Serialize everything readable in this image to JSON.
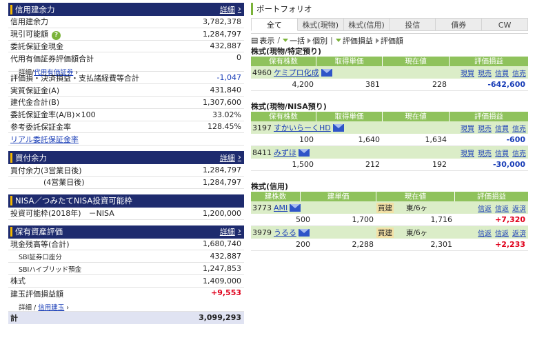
{
  "credit": {
    "title": "信用建余力",
    "detail": "詳細",
    "rows": [
      {
        "label": "信用建余力",
        "value": "3,782,378"
      },
      {
        "label": "現引可能額",
        "value": "1,284,797"
      },
      {
        "label": "委託保証金現金",
        "value": "432,887"
      },
      {
        "label": "代用有価証券評価額合計",
        "value": "0",
        "sub_prefix": "詳細/",
        "sub_link": "代用有価証券"
      },
      {
        "label": "評価損・決済損益・支払諸経費等合計",
        "value": "-1,047"
      },
      {
        "label": "実質保証金(A)",
        "value": "431,840"
      },
      {
        "label": "建代金合計(B)",
        "value": "1,307,600"
      },
      {
        "label": "委託保証金率(A/B)×100",
        "value": "33.02%"
      },
      {
        "label": "参考委託保証金率",
        "value": "128.45%"
      }
    ],
    "real_link": "リアル委託保証金率"
  },
  "buying": {
    "title": "買付余力",
    "detail": "詳細",
    "rows": [
      {
        "label": "買付余力(3営業日後)",
        "value": "1,284,797"
      },
      {
        "label": "(4営業日後)",
        "value": "1,284,797"
      }
    ]
  },
  "nisa": {
    "title": "NISA／つみたてNISA投資可能枠",
    "row": {
      "label": "投資可能枠(2018年)　－NISA",
      "value": "1,200,000"
    }
  },
  "assets": {
    "title": "保有資産評価",
    "detail": "詳細",
    "rows": [
      {
        "label": "現金残高等(合計)",
        "value": "1,680,740"
      },
      {
        "label": "SBI証券口座分",
        "value": "432,887",
        "sub": true
      },
      {
        "label": "SBIハイブリッド預金",
        "value": "1,247,853",
        "sub": true
      },
      {
        "label": "株式",
        "value": "1,409,000"
      }
    ],
    "pl": {
      "label": "建玉評価損益額",
      "value": "+9,553",
      "sub_prefix": "詳細 / ",
      "sub_link": "信用建玉"
    },
    "total": {
      "label": "計",
      "value": "3,099,293"
    }
  },
  "portfolio": {
    "title": "ポートフォリオ",
    "tabs": [
      "全て",
      "株式(現物)",
      "株式(信用)",
      "投信",
      "債券",
      "CW"
    ],
    "toolbar": {
      "display": "表示",
      "all": "一括",
      "each": "個別",
      "pl": "評価損益",
      "value": "評価額"
    },
    "spec": {
      "title": "株式(現物/特定預り)",
      "headers": [
        "保有株数",
        "取得単価",
        "現在値",
        "評価損益"
      ],
      "items": [
        {
          "code": "4960",
          "name": "ケミプロ化成",
          "qty": "4,200",
          "cost": "381",
          "price": "228",
          "pl": "-642,600"
        }
      ]
    },
    "nisa": {
      "title": "株式(現物/NISA預り)",
      "headers": [
        "保有株数",
        "取得単価",
        "現在値",
        "評価損益"
      ],
      "items": [
        {
          "code": "3197",
          "name": "すかいらーくHD",
          "qty": "100",
          "cost": "1,640",
          "price": "1,634",
          "pl": "-600"
        },
        {
          "code": "8411",
          "name": "みずほ",
          "qty": "1,500",
          "cost": "212",
          "price": "192",
          "pl": "-30,000"
        }
      ]
    },
    "genbutsu_actions": [
      "現買",
      "現売",
      "信買",
      "信売"
    ],
    "margin": {
      "title": "株式(信用)",
      "headers": [
        "建株数",
        "建単価",
        "現在値",
        "評価損益"
      ],
      "items": [
        {
          "code": "3773",
          "name": "AMI",
          "qty": "500",
          "cost": "1,700",
          "type": "買建",
          "market": "東/6ヶ",
          "price": "1,716",
          "pl": "+7,320"
        },
        {
          "code": "3979",
          "name": "うるる",
          "qty": "200",
          "cost": "2,288",
          "type": "買建",
          "market": "東/6ヶ",
          "price": "2,301",
          "pl": "+2,233"
        }
      ]
    },
    "margin_actions": [
      "信返",
      "信返",
      "返済"
    ]
  },
  "colors": {
    "header_bg": "#1e2b6e",
    "accent": "#f5b800",
    "green": "#8fc25c",
    "light_green": "#dbedc8",
    "link": "#1a3eb7",
    "positive": "#e0001b"
  },
  "icons": {
    "mail": "mail-icon",
    "help": "help-icon",
    "chevron": "chevron-right-icon"
  }
}
